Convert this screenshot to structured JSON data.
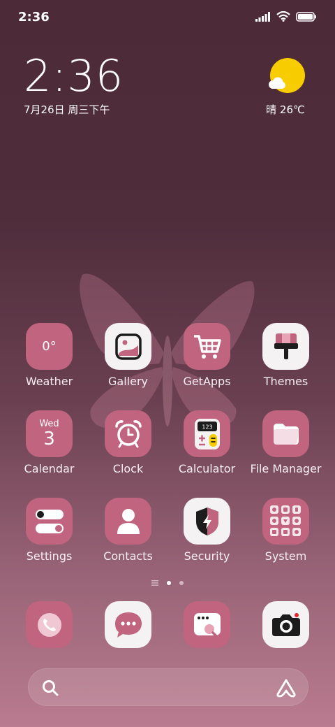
{
  "status_bar": {
    "time": "2:36",
    "signal_icon": "signal-icon",
    "wifi_icon": "wifi-icon",
    "battery_icon": "battery-icon"
  },
  "clock_widget": {
    "time": "2:36",
    "date": "7月26日 周三下午"
  },
  "weather_widget": {
    "icon": "sun-cloud-icon",
    "text": "晴 26℃"
  },
  "apps": [
    [
      {
        "label": "Weather",
        "icon": "weather-icon",
        "icon_text": "0°"
      },
      {
        "label": "Gallery",
        "icon": "gallery-icon"
      },
      {
        "label": "GetApps",
        "icon": "cart-icon"
      },
      {
        "label": "Themes",
        "icon": "brush-icon"
      }
    ],
    [
      {
        "label": "Calendar",
        "icon": "calendar-icon",
        "icon_day": "Wed",
        "icon_date": "3"
      },
      {
        "label": "Clock",
        "icon": "alarm-clock-icon"
      },
      {
        "label": "Calculator",
        "icon": "calculator-icon",
        "icon_text": "123"
      },
      {
        "label": "File Manager",
        "icon": "folder-icon"
      }
    ],
    [
      {
        "label": "Settings",
        "icon": "toggles-icon"
      },
      {
        "label": "Contacts",
        "icon": "person-icon"
      },
      {
        "label": "Security",
        "icon": "shield-icon"
      },
      {
        "label": "System",
        "icon": "folder-grid-icon"
      }
    ]
  ],
  "page_indicator": {
    "pages": 2,
    "active": 1
  },
  "dock": [
    {
      "name": "phone",
      "icon": "phone-icon"
    },
    {
      "name": "messages",
      "icon": "chat-bubble-icon"
    },
    {
      "name": "browser",
      "icon": "browser-icon"
    },
    {
      "name": "camera",
      "icon": "camera-icon"
    }
  ],
  "search": {
    "icon": "search-icon",
    "assistant_icon": "assistant-icon"
  },
  "colors": {
    "accent_pink": "#c0647f",
    "icon_white": "#f5f2f3",
    "dark": "#1c1c1c",
    "sun": "#f7cc00"
  }
}
